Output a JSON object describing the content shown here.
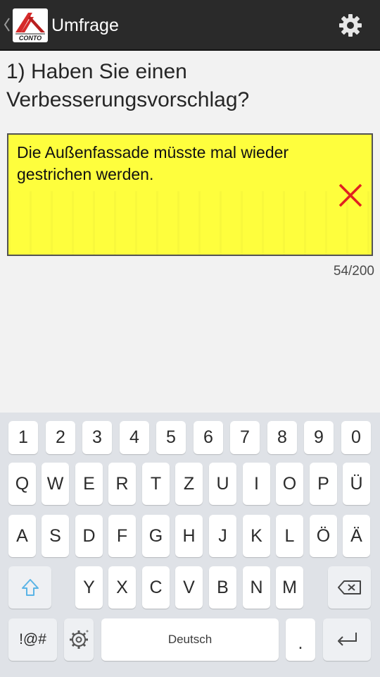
{
  "app_bar": {
    "title": "Umfrage",
    "logo_text": "CONTO",
    "colors": {
      "background": "#2a2a2a",
      "logo_red": "#d62b2b"
    },
    "icons": {
      "back": "chevron-left-icon",
      "logo": "app-logo-icon",
      "settings": "gear-icon"
    }
  },
  "survey": {
    "question": "1) Haben Sie einen Verbesserungsvorschlag?",
    "answer": "Die Außenfassade müsste mal wieder gestrichen werden.",
    "char_counter": "54/200",
    "colors": {
      "answer_background": "#fefe3d",
      "clear_icon": "#e02020"
    },
    "icons": {
      "clear": "clear-x-icon"
    }
  },
  "keyboard": {
    "number_row": [
      "1",
      "2",
      "3",
      "4",
      "5",
      "6",
      "7",
      "8",
      "9",
      "0"
    ],
    "row1": [
      "Q",
      "W",
      "E",
      "R",
      "T",
      "Z",
      "U",
      "I",
      "O",
      "P",
      "Ü"
    ],
    "row2": [
      "A",
      "S",
      "D",
      "F",
      "G",
      "H",
      "J",
      "K",
      "L",
      "Ö",
      "Ä"
    ],
    "row3": [
      "Y",
      "X",
      "C",
      "V",
      "B",
      "N",
      "M"
    ],
    "symbols_label": "!@#",
    "space_label": "Deutsch",
    "period_label": ".",
    "icons": {
      "shift": "shift-arrow-icon",
      "backspace": "backspace-icon",
      "settings": "keyboard-settings-gear-icon",
      "enter": "enter-arrow-icon"
    },
    "colors": {
      "shift_arrow": "#5ab4e6"
    }
  }
}
